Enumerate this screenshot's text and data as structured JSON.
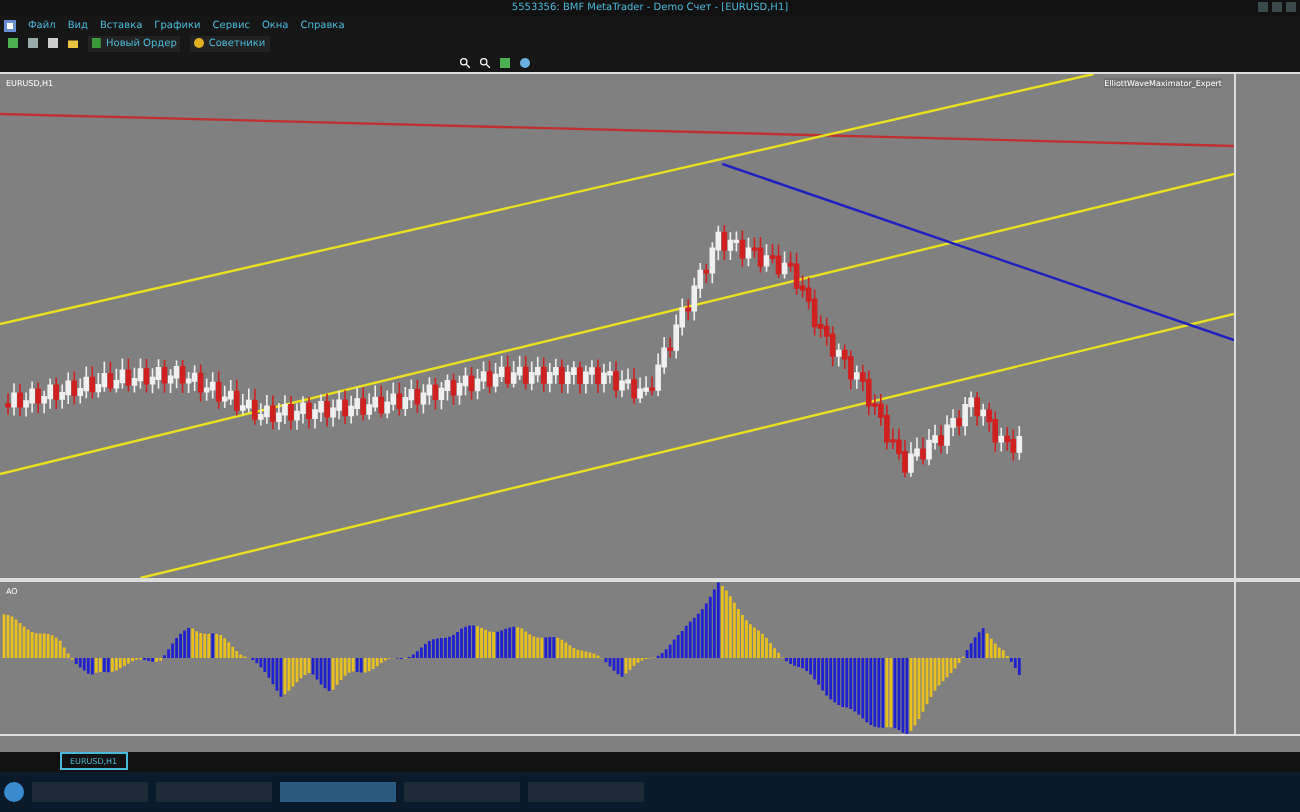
{
  "window": {
    "title": "5553356: BMF MetaTrader - Demo Счет - [EURUSD,H1]"
  },
  "menu": [
    "Файл",
    "Вид",
    "Вставка",
    "Графики",
    "Сервис",
    "Окна",
    "Справка"
  ],
  "toolbar": {
    "buttons": [
      {
        "label": "Новый Ордер",
        "kind": "order"
      },
      {
        "label": "Советники",
        "kind": "experts"
      }
    ]
  },
  "chart": {
    "symbol_label": "EURUSD,H1",
    "expert_label": "ElliottWaveMaximator_Expert"
  },
  "indicator": {
    "label": "AO"
  },
  "tabs": [
    {
      "label": "EURUSD,H1",
      "selected": true
    }
  ]
}
